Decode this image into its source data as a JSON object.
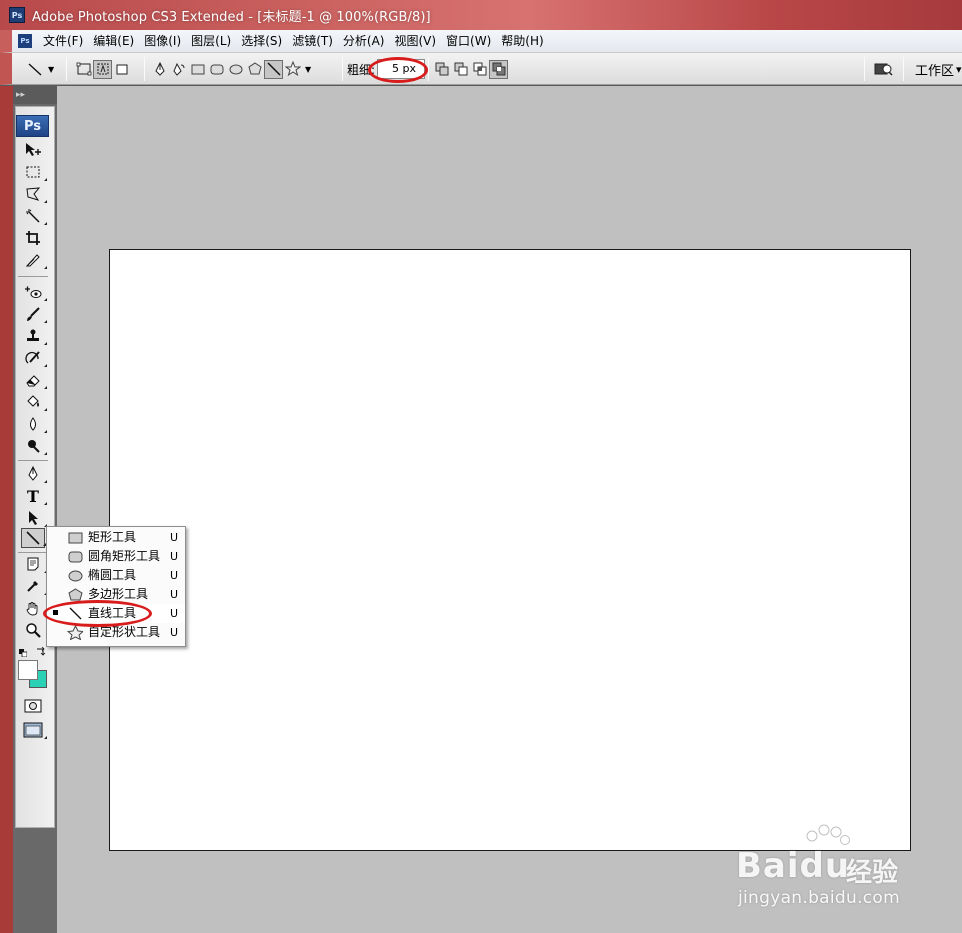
{
  "app": {
    "icon_label": "Ps",
    "title": "Adobe Photoshop CS3 Extended - [未标题-1 @ 100%(RGB/8)]"
  },
  "menu": {
    "items": [
      {
        "label": "文件(F)"
      },
      {
        "label": "编辑(E)"
      },
      {
        "label": "图像(I)"
      },
      {
        "label": "图层(L)"
      },
      {
        "label": "选择(S)"
      },
      {
        "label": "滤镜(T)"
      },
      {
        "label": "分析(A)"
      },
      {
        "label": "视图(V)"
      },
      {
        "label": "窗口(W)"
      },
      {
        "label": "帮助(H)"
      }
    ]
  },
  "options": {
    "weight_label": "粗细:",
    "weight_value": "5 px",
    "workspace_label": "工作区",
    "workspace_arrow": "▾"
  },
  "toolbox": {
    "grip": "▸▸",
    "logo": "Ps",
    "text_tool_glyph": "T",
    "foreground_color": "#ffffff",
    "background_color": "#2ad1b4"
  },
  "flyout": {
    "items": [
      {
        "label": "矩形工具",
        "key": "U",
        "icon": "rectangle-icon",
        "selected": false
      },
      {
        "label": "圆角矩形工具",
        "key": "U",
        "icon": "rounded-rectangle-icon",
        "selected": false
      },
      {
        "label": "椭圆工具",
        "key": "U",
        "icon": "ellipse-icon",
        "selected": false
      },
      {
        "label": "多边形工具",
        "key": "U",
        "icon": "polygon-icon",
        "selected": false
      },
      {
        "label": "直线工具",
        "key": "U",
        "icon": "line-icon",
        "selected": true
      },
      {
        "label": "自定形状工具",
        "key": "U",
        "icon": "custom-shape-icon",
        "selected": false
      }
    ]
  },
  "annotations": {
    "highlight_color": "#d81b1b"
  },
  "watermark": {
    "brand": "Baidu",
    "sub": "经验",
    "url": "jingyan.baidu.com"
  }
}
